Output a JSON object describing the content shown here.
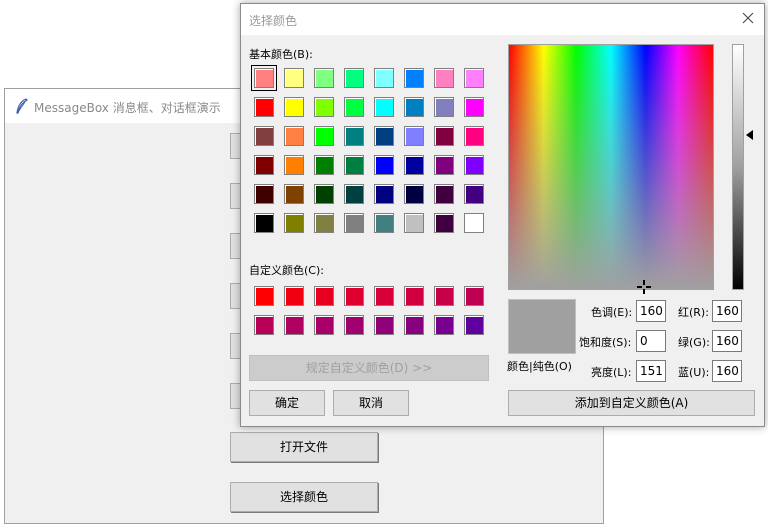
{
  "main_window": {
    "title": "MessageBox 消息框、对话框演示",
    "buttons": [
      {
        "name": "open-file-button",
        "label": "打开文件"
      },
      {
        "name": "choose-color-button",
        "label": "选择颜色"
      }
    ]
  },
  "dialog": {
    "title": "选择颜色",
    "basic_colors_label": "基本颜色(B):",
    "custom_colors_label": "自定义颜色(C):",
    "define_custom_label": "规定自定义颜色(D) >>",
    "ok_label": "确定",
    "cancel_label": "取消",
    "add_custom_label": "添加到自定义颜色(A)",
    "color_solid_label": "颜色|纯色(O)",
    "fields": {
      "hue": {
        "label": "色调(E):",
        "value": "160"
      },
      "sat": {
        "label": "饱和度(S):",
        "value": "0"
      },
      "lum": {
        "label": "亮度(L):",
        "value": "151"
      },
      "red": {
        "label": "红(R):",
        "value": "160"
      },
      "green": {
        "label": "绿(G):",
        "value": "160"
      },
      "blue": {
        "label": "蓝(U):",
        "value": "160"
      }
    },
    "basic_colors": [
      "#ff8080",
      "#ffff80",
      "#80ff80",
      "#00ff80",
      "#80ffff",
      "#0080ff",
      "#ff80c0",
      "#ff80ff",
      "#ff0000",
      "#ffff00",
      "#80ff00",
      "#00ff40",
      "#00ffff",
      "#0080c0",
      "#8080c0",
      "#ff00ff",
      "#804040",
      "#ff8040",
      "#00ff00",
      "#008080",
      "#004080",
      "#8080ff",
      "#800040",
      "#ff0080",
      "#800000",
      "#ff8000",
      "#008000",
      "#008040",
      "#0000ff",
      "#0000a0",
      "#800080",
      "#8000ff",
      "#400000",
      "#804000",
      "#004000",
      "#004040",
      "#000080",
      "#000040",
      "#400040",
      "#400080",
      "#000000",
      "#808000",
      "#808040",
      "#808080",
      "#408080",
      "#c0c0c0",
      "#400040",
      "#ffffff"
    ],
    "custom_colors": [
      "#ff0000",
      "#f00010",
      "#e80020",
      "#e00030",
      "#d80038",
      "#d00040",
      "#c80048",
      "#c00050",
      "#b80058",
      "#b00060",
      "#a80068",
      "#a00070",
      "#900078",
      "#880080",
      "#780090",
      "#6000a0"
    ]
  }
}
